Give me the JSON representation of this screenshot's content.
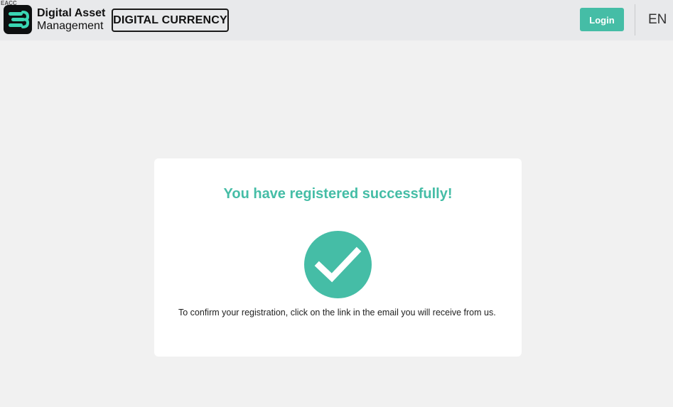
{
  "header": {
    "corner_tag": "EACC",
    "logo_line1": "Digital Asset",
    "logo_line2": "Management",
    "badge": "DIGITAL CURRENCY",
    "login_label": "Login",
    "language": "EN"
  },
  "card": {
    "title": "You have registered successfully!",
    "message": "To confirm your registration, click on the link in the email you will receive from us.",
    "icon": "checkmark-circle-icon"
  },
  "colors": {
    "accent": "#45bda6",
    "header_bg": "#e8e9eb",
    "page_bg": "#f1f1f1",
    "logo_bg": "#0d0f10"
  }
}
